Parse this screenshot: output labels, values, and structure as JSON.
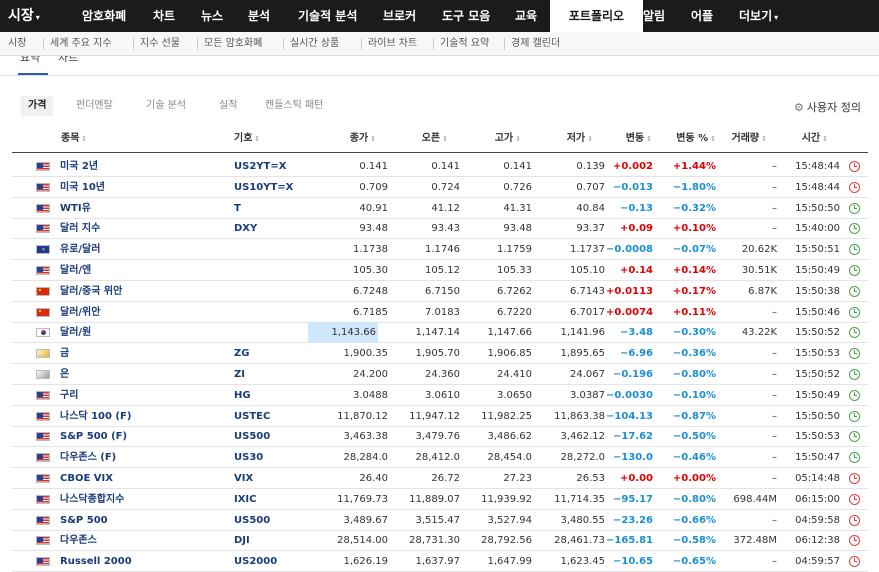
{
  "topnav": {
    "items": [
      "시장",
      "암호화폐",
      "차트",
      "뉴스",
      "분석",
      "기술적 분석",
      "브로커",
      "도구 모음",
      "교육",
      "포트폴리오",
      "알림",
      "어플",
      "더보기"
    ]
  },
  "subnav": {
    "items": [
      "시장",
      "세계 주요 지수",
      "지수 선물",
      "모든 암호화폐",
      "실시간 상품",
      "라이브 차트",
      "기술적 요약",
      "경제 캘린더"
    ]
  },
  "clipped_tabs": [
    "요약",
    "차트"
  ],
  "inner_tabs": [
    "가격",
    "펀더멘탈",
    "기술 분석",
    "실적",
    "캔들스틱 패턴"
  ],
  "settings_label": "사용자 정의",
  "headers": [
    "종목",
    "기호",
    "종가",
    "오픈",
    "고가",
    "저가",
    "변동",
    "변동 %",
    "거래량",
    "시간"
  ],
  "rows": [
    {
      "flag": "us",
      "name": "미국 2년",
      "symbol": "US2YT=X",
      "last": "0.141",
      "open": "0.141",
      "high": "0.141",
      "low": "0.139",
      "chg": "+0.002",
      "chgp": "+1.44%",
      "vol": "–",
      "time": "15:48:44",
      "status": "closed"
    },
    {
      "flag": "us",
      "name": "미국 10년",
      "symbol": "US10YT=X",
      "last": "0.709",
      "open": "0.724",
      "high": "0.726",
      "low": "0.707",
      "chg": "−0.013",
      "chgp": "−1.80%",
      "vol": "–",
      "time": "15:48:44",
      "status": "closed"
    },
    {
      "flag": "us",
      "name": "WTI유",
      "symbol": "T",
      "last": "40.91",
      "open": "41.12",
      "high": "41.31",
      "low": "40.84",
      "chg": "−0.13",
      "chgp": "−0.32%",
      "vol": "–",
      "time": "15:50:50",
      "status": "open"
    },
    {
      "flag": "us",
      "name": "달러 지수",
      "symbol": "DXY",
      "last": "93.48",
      "open": "93.43",
      "high": "93.48",
      "low": "93.37",
      "chg": "+0.09",
      "chgp": "+0.10%",
      "vol": "–",
      "time": "15:40:00",
      "status": "open"
    },
    {
      "flag": "eu",
      "name": "유로/달러",
      "symbol": "",
      "last": "1.1738",
      "open": "1.1746",
      "high": "1.1759",
      "low": "1.1737",
      "chg": "−0.0008",
      "chgp": "−0.07%",
      "vol": "20.62K",
      "time": "15:50:51",
      "status": "open"
    },
    {
      "flag": "us",
      "name": "달러/엔",
      "symbol": "",
      "last": "105.30",
      "open": "105.12",
      "high": "105.33",
      "low": "105.10",
      "chg": "+0.14",
      "chgp": "+0.14%",
      "vol": "30.51K",
      "time": "15:50:49",
      "status": "open"
    },
    {
      "flag": "cn",
      "name": "달러/중국 위안",
      "symbol": "",
      "last": "6.7248",
      "open": "6.7150",
      "high": "6.7262",
      "low": "6.7143",
      "chg": "+0.0113",
      "chgp": "+0.17%",
      "vol": "6.87K",
      "time": "15:50:38",
      "status": "open"
    },
    {
      "flag": "cn",
      "name": "달러/위안",
      "symbol": "",
      "last": "6.7185",
      "open": "7.0183",
      "high": "6.7220",
      "low": "6.7017",
      "chg": "+0.0074",
      "chgp": "+0.11%",
      "vol": "–",
      "time": "15:50:46",
      "status": "open"
    },
    {
      "flag": "kr",
      "name": "달러/원",
      "symbol": "",
      "last": "1,143.66",
      "open": "1,147.14",
      "high": "1,147.66",
      "low": "1,141.96",
      "chg": "−3.48",
      "chgp": "−0.30%",
      "vol": "43.22K",
      "time": "15:50:52",
      "status": "open",
      "highlight": true
    },
    {
      "flag": "gold",
      "name": "금",
      "symbol": "ZG",
      "last": "1,900.35",
      "open": "1,905.70",
      "high": "1,906.85",
      "low": "1,895.65",
      "chg": "−6.96",
      "chgp": "−0.36%",
      "vol": "–",
      "time": "15:50:53",
      "status": "open"
    },
    {
      "flag": "silver",
      "name": "은",
      "symbol": "ZI",
      "last": "24.200",
      "open": "24.360",
      "high": "24.410",
      "low": "24.067",
      "chg": "−0.196",
      "chgp": "−0.80%",
      "vol": "–",
      "time": "15:50:52",
      "status": "open"
    },
    {
      "flag": "us",
      "name": "구리",
      "symbol": "HG",
      "last": "3.0488",
      "open": "3.0610",
      "high": "3.0650",
      "low": "3.0387",
      "chg": "−0.0030",
      "chgp": "−0.10%",
      "vol": "–",
      "time": "15:50:49",
      "status": "open"
    },
    {
      "flag": "us",
      "name": "나스닥 100 (F)",
      "symbol": "USTEC",
      "last": "11,870.12",
      "open": "11,947.12",
      "high": "11,982.25",
      "low": "11,863.38",
      "chg": "−104.13",
      "chgp": "−0.87%",
      "vol": "–",
      "time": "15:50:50",
      "status": "open"
    },
    {
      "flag": "us",
      "name": "S&P 500 (F)",
      "symbol": "US500",
      "last": "3,463.38",
      "open": "3,479.76",
      "high": "3,486.62",
      "low": "3,462.12",
      "chg": "−17.62",
      "chgp": "−0.50%",
      "vol": "–",
      "time": "15:50:53",
      "status": "open"
    },
    {
      "flag": "us",
      "name": "다우존스 (F)",
      "symbol": "US30",
      "last": "28,284.0",
      "open": "28,412.0",
      "high": "28,454.0",
      "low": "28,272.0",
      "chg": "−130.0",
      "chgp": "−0.46%",
      "vol": "–",
      "time": "15:50:47",
      "status": "open"
    },
    {
      "flag": "us",
      "name": "CBOE VIX",
      "symbol": "VIX",
      "last": "26.40",
      "open": "26.72",
      "high": "27.23",
      "low": "26.53",
      "chg": "+0.00",
      "chgp": "+0.00%",
      "vol": "–",
      "time": "05:14:48",
      "status": "closed"
    },
    {
      "flag": "us",
      "name": "나스닥종합지수",
      "symbol": "IXIC",
      "last": "11,769.73",
      "open": "11,889.07",
      "high": "11,939.92",
      "low": "11,714.35",
      "chg": "−95.17",
      "chgp": "−0.80%",
      "vol": "698.44M",
      "time": "06:15:00",
      "status": "closed"
    },
    {
      "flag": "us",
      "name": "S&P 500",
      "symbol": "US500",
      "last": "3,489.67",
      "open": "3,515.47",
      "high": "3,527.94",
      "low": "3,480.55",
      "chg": "−23.26",
      "chgp": "−0.66%",
      "vol": "–",
      "time": "04:59:58",
      "status": "closed"
    },
    {
      "flag": "us",
      "name": "다우존스",
      "symbol": "DJI",
      "last": "28,514.00",
      "open": "28,731.30",
      "high": "28,792.56",
      "low": "28,461.73",
      "chg": "−165.81",
      "chgp": "−0.58%",
      "vol": "372.48M",
      "time": "06:12:38",
      "status": "closed"
    },
    {
      "flag": "us",
      "name": "Russell 2000",
      "symbol": "US2000",
      "last": "1,626.19",
      "open": "1,637.97",
      "high": "1,647.99",
      "low": "1,623.45",
      "chg": "−10.65",
      "chgp": "−0.65%",
      "vol": "–",
      "time": "04:59:57",
      "status": "closed"
    }
  ]
}
